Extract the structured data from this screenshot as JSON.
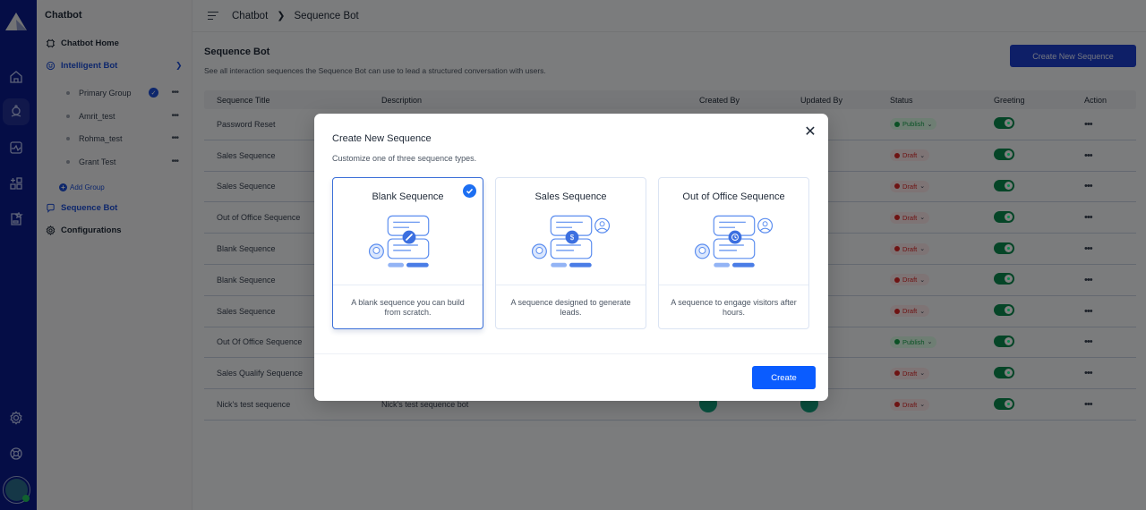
{
  "sidebar": {
    "title": "Chatbot",
    "items": [
      {
        "label": "Chatbot Home",
        "icon": "chip-icon"
      },
      {
        "label": "Intelligent Bot",
        "icon": "bot-face-icon",
        "expanded": true
      },
      {
        "label": "Sequence Bot",
        "icon": "chat-bubble-icon"
      },
      {
        "label": "Configurations",
        "icon": "gear-icon"
      }
    ],
    "groups": [
      {
        "label": "Primary Group",
        "selected": true
      },
      {
        "label": "Amrit_test"
      },
      {
        "label": "Rohma_test"
      },
      {
        "label": "Grant Test"
      }
    ],
    "add_group": "Add Group"
  },
  "rail": {
    "icons": [
      "home-icon",
      "bot-icon",
      "analytics-icon",
      "apps-icon",
      "report-icon",
      "settings-icon",
      "help-lifebuoy-icon",
      "user-avatar"
    ]
  },
  "header": {
    "breadcrumb": [
      "Chatbot",
      "Sequence Bot"
    ]
  },
  "page": {
    "title": "Sequence Bot",
    "description": "See all interaction sequences the Sequence Bot can use to lead a structured conversation with users.",
    "create_button": "Create New Sequence"
  },
  "table": {
    "columns": [
      "Sequence Title",
      "Description",
      "Created By",
      "Updated By",
      "Status",
      "Greeting",
      "Action"
    ],
    "rows": [
      {
        "title": "Password Reset",
        "description": "",
        "status": "Publish",
        "greeting": true
      },
      {
        "title": "Sales Sequence",
        "description": "",
        "status": "Draft",
        "greeting": true
      },
      {
        "title": "Sales Sequence",
        "description": "",
        "status": "Draft",
        "greeting": true
      },
      {
        "title": "Out of Office Sequence",
        "description": "",
        "status": "Draft",
        "greeting": true
      },
      {
        "title": "Blank Sequence",
        "description": "",
        "status": "Draft",
        "greeting": true
      },
      {
        "title": "Blank Sequence",
        "description": "",
        "status": "Draft",
        "greeting": true
      },
      {
        "title": "Sales Sequence",
        "description": "",
        "status": "Draft",
        "greeting": true
      },
      {
        "title": "Out Of Office Sequence",
        "description": "",
        "status": "Publish",
        "greeting": true
      },
      {
        "title": "Sales Qualify Sequence",
        "description": "",
        "status": "Draft",
        "greeting": true
      },
      {
        "title": "Nick's test sequence",
        "description": "Nick's test sequence bot",
        "status": "Draft",
        "greeting": true
      }
    ]
  },
  "modal": {
    "title": "Create New Sequence",
    "subtitle": "Customize one of three sequence types.",
    "cards": [
      {
        "title": "Blank Sequence",
        "description": "A blank sequence you can build from scratch.",
        "badge_icon": "pencil-icon",
        "selected": true
      },
      {
        "title": "Sales Sequence",
        "description": "A sequence designed to generate leads.",
        "badge_icon": "dollar-icon",
        "selected": false
      },
      {
        "title": "Out of Office Sequence",
        "description": "A sequence to engage visitors after hours.",
        "badge_icon": "clock-history-icon",
        "selected": false
      }
    ],
    "create_button": "Create",
    "close_icon": "close-icon"
  },
  "colors": {
    "rail": "#0b1a8c",
    "primary": "#0a5cff",
    "draft": "#dc2626",
    "publish": "#16a34a",
    "toggle_on": "#0a8a4e"
  }
}
